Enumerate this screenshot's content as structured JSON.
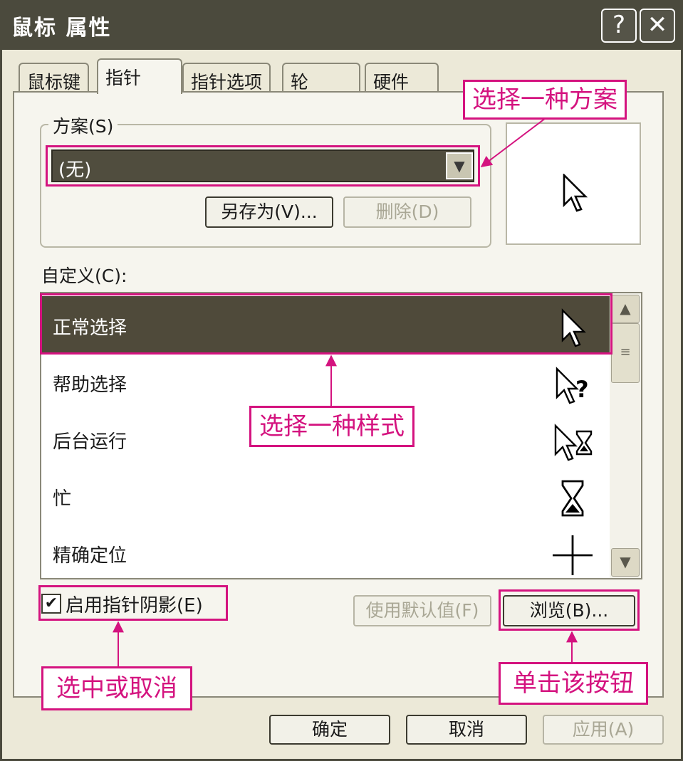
{
  "window": {
    "title": "鼠标 属性",
    "help_glyph": "?",
    "close_glyph": "✕"
  },
  "tabs": [
    {
      "label": "鼠标键"
    },
    {
      "label": "指针",
      "active": true
    },
    {
      "label": "指针选项"
    },
    {
      "label": "轮"
    },
    {
      "label": "硬件"
    }
  ],
  "scheme": {
    "legend": "方案(S)",
    "selected": "(无)",
    "save_as_label": "另存为(V)...",
    "delete_label": "删除(D)"
  },
  "customize": {
    "label": "自定义(C):",
    "items": [
      {
        "label": "正常选择",
        "icon": "arrow-pointer-icon",
        "selected": true
      },
      {
        "label": "帮助选择",
        "icon": "help-pointer-icon"
      },
      {
        "label": "后台运行",
        "icon": "working-in-background-icon"
      },
      {
        "label": "忙",
        "icon": "hourglass-icon"
      },
      {
        "label": "精确定位",
        "icon": "crosshair-icon"
      }
    ]
  },
  "options": {
    "shadow_label": "启用指针阴影(E)",
    "shadow_checked": true,
    "default_label": "使用默认值(F)",
    "browse_label": "浏览(B)..."
  },
  "footer": {
    "ok_label": "确定",
    "cancel_label": "取消",
    "apply_label": "应用(A)"
  },
  "annotations": {
    "scheme_note": "选择一种方案",
    "style_note": "选择一种样式",
    "shadow_note": "选中或取消",
    "browse_note": "单击该按钮"
  },
  "colors": {
    "annotation": "#d4137f",
    "selection": "#4f4a3a",
    "titlebar": "#4b4a3d"
  }
}
